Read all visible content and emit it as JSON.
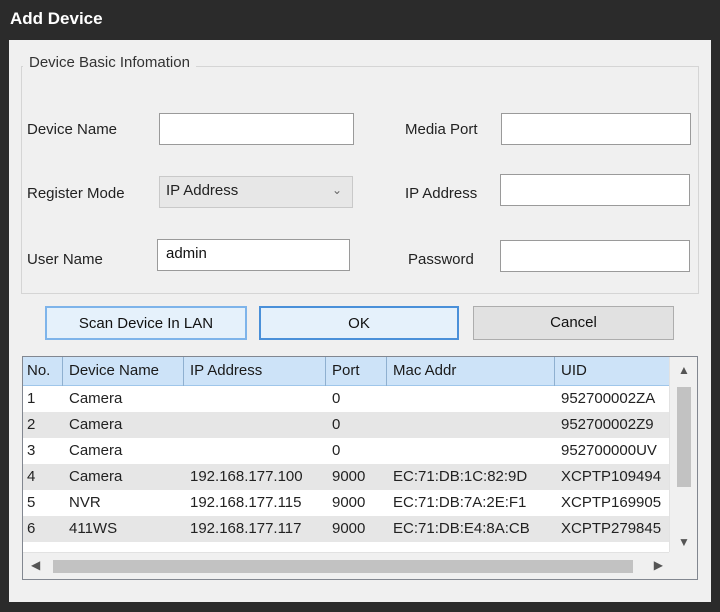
{
  "window": {
    "title": "Add Device"
  },
  "basic_info": {
    "legend": "Device Basic Infomation",
    "device_name": {
      "label": "Device Name",
      "value": ""
    },
    "media_port": {
      "label": "Media Port",
      "value": ""
    },
    "register_mode": {
      "label": "Register Mode",
      "value": "IP Address"
    },
    "ip_address": {
      "label": "IP Address",
      "value": ""
    },
    "user_name": {
      "label": "User Name",
      "value": "admin"
    },
    "password": {
      "label": "Password",
      "value": ""
    }
  },
  "buttons": {
    "scan": "Scan Device In LAN",
    "ok": "OK",
    "cancel": "Cancel"
  },
  "table": {
    "columns": [
      "No.",
      "Device Name",
      "IP Address",
      "Port",
      "Mac Addr",
      "UID"
    ],
    "rows": [
      [
        "1",
        "Camera",
        "",
        "0",
        "",
        "952700002ZA"
      ],
      [
        "2",
        "Camera",
        "",
        "0",
        "",
        "952700002Z9"
      ],
      [
        "3",
        "Camera",
        "",
        "0",
        "",
        "952700000UV"
      ],
      [
        "4",
        "Camera",
        "192.168.177.100",
        "9000",
        "EC:71:DB:1C:82:9D",
        "XCPTP109494"
      ],
      [
        "5",
        "NVR",
        "192.168.177.115",
        "9000",
        "EC:71:DB:7A:2E:F1",
        "XCPTP169905"
      ],
      [
        "6",
        "411WS",
        "192.168.177.117",
        "9000",
        "EC:71:DB:E4:8A:CB",
        "XCPTP279845"
      ]
    ]
  },
  "colors": {
    "title_bar": "#2b2b2b",
    "header": "#cde3f8",
    "row_alt": "#e6e6e6",
    "button_focus": "#4a90d9"
  },
  "icons": {
    "dropdown": "chevron-down-icon",
    "scroll_up": "arrow-up-icon",
    "scroll_down": "arrow-down-icon",
    "scroll_left": "arrow-left-icon",
    "scroll_right": "arrow-right-icon"
  }
}
